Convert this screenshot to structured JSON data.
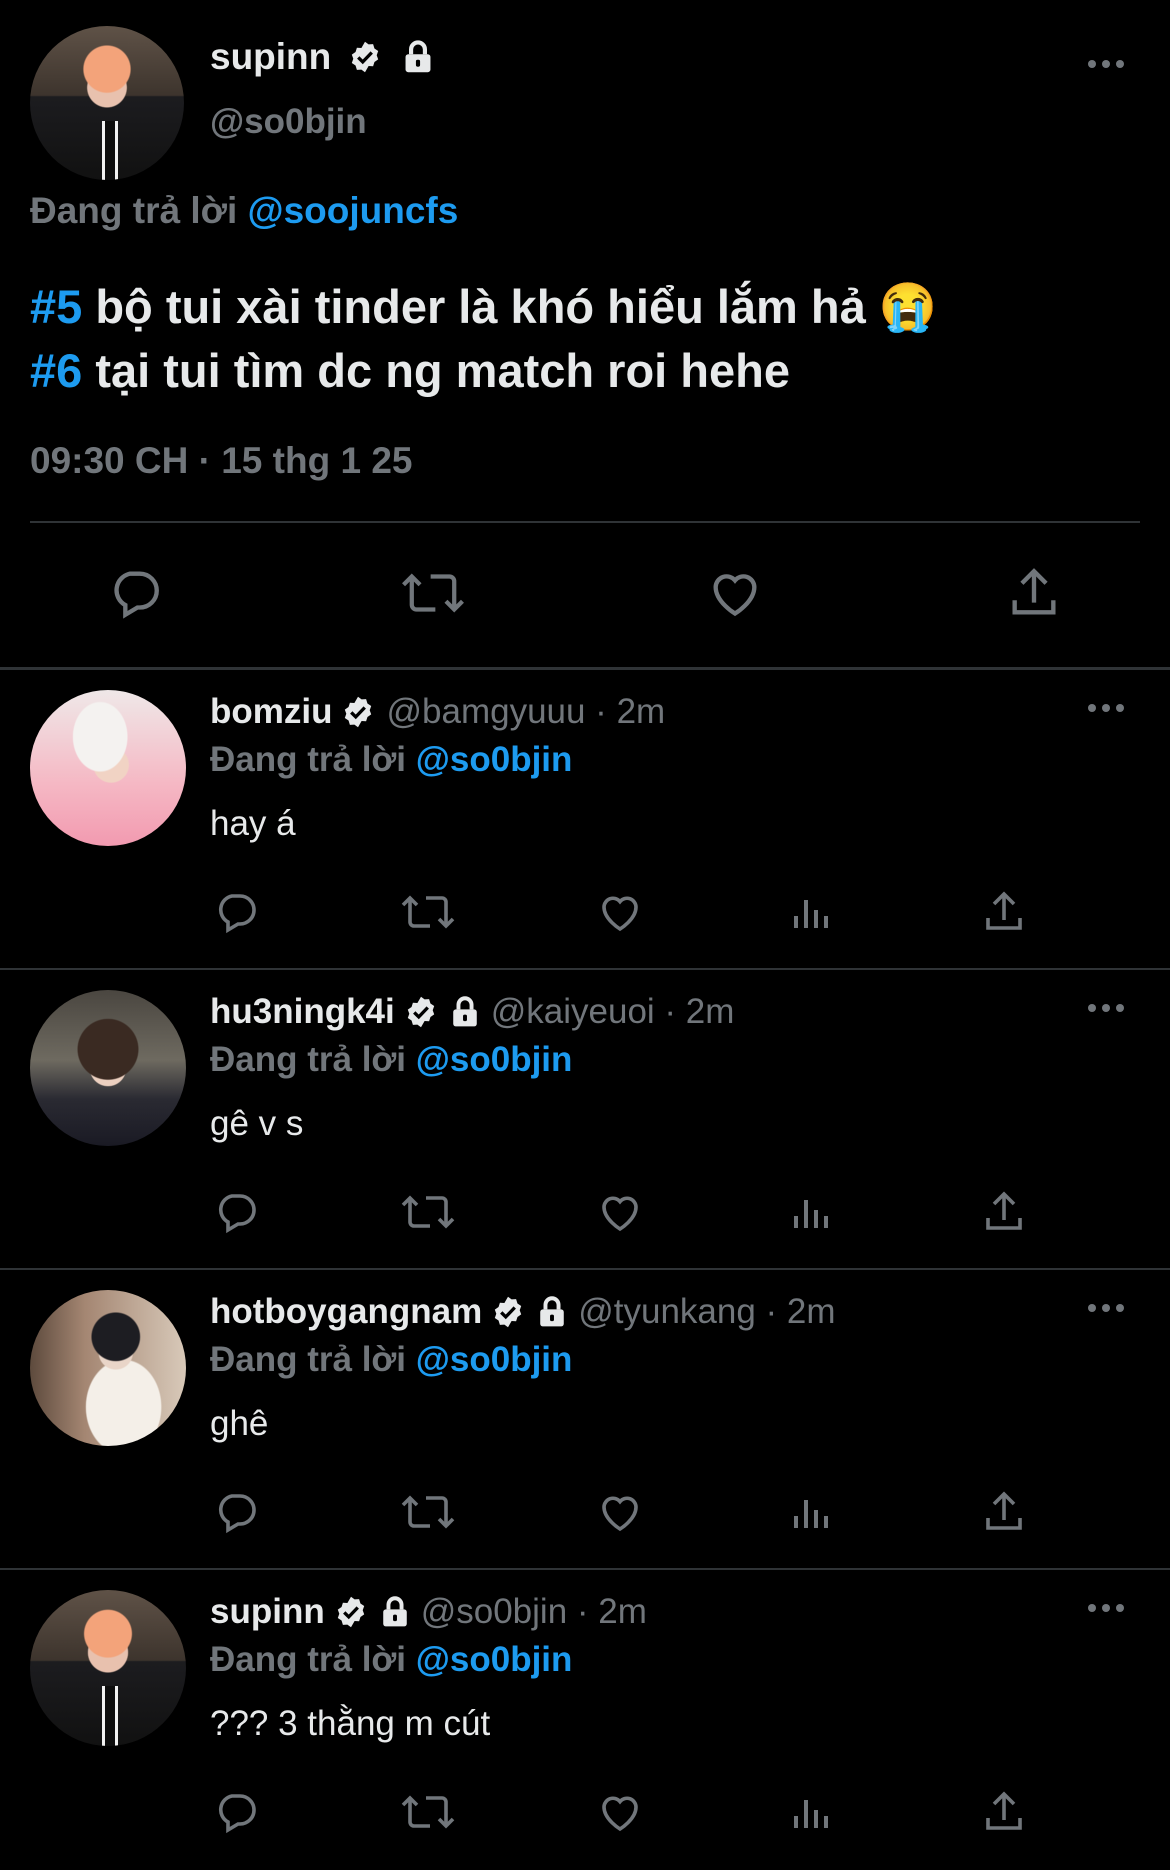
{
  "main": {
    "name": "supinn",
    "handle": "@so0bjin",
    "replying_prefix": "Đang trả lời",
    "replying_to": "@soojuncfs",
    "line1_tag": "#5",
    "line1_text": " bộ tui xài tinder là khó hiểu lắm hả 😭",
    "line2_tag": "#6",
    "line2_text": " tại tui tìm dc ng match roi hehe",
    "meta": "09:30 CH · 15 thg 1 25"
  },
  "replies": [
    {
      "name": "bomziu",
      "handle": "@bamgyuuu · 2m",
      "replying_prefix": "Đang trả lời",
      "replying_to": "@so0bjin",
      "text": "hay á"
    },
    {
      "name": "hu3ningk4i",
      "handle": "@kaiyeuoi · 2m",
      "replying_prefix": "Đang trả lời",
      "replying_to": "@so0bjin",
      "text": "gê v s"
    },
    {
      "name": "hotboygangnam",
      "handle": "@tyunkang · 2m",
      "replying_prefix": "Đang trả lời",
      "replying_to": "@so0bjin",
      "text": "ghê"
    },
    {
      "name": "supinn",
      "handle": "@so0bjin · 2m",
      "replying_prefix": "Đang trả lời",
      "replying_to": "@so0bjin",
      "text": "??? 3 thằng m cút"
    }
  ],
  "colors": {
    "background": "#000000",
    "accent": "#1d9bf0",
    "muted": "#71767b",
    "text": "#e7e9ea"
  },
  "icons": [
    "verified-icon",
    "lock-icon",
    "more-icon",
    "reply-icon",
    "retweet-icon",
    "like-icon",
    "views-icon",
    "share-icon"
  ]
}
